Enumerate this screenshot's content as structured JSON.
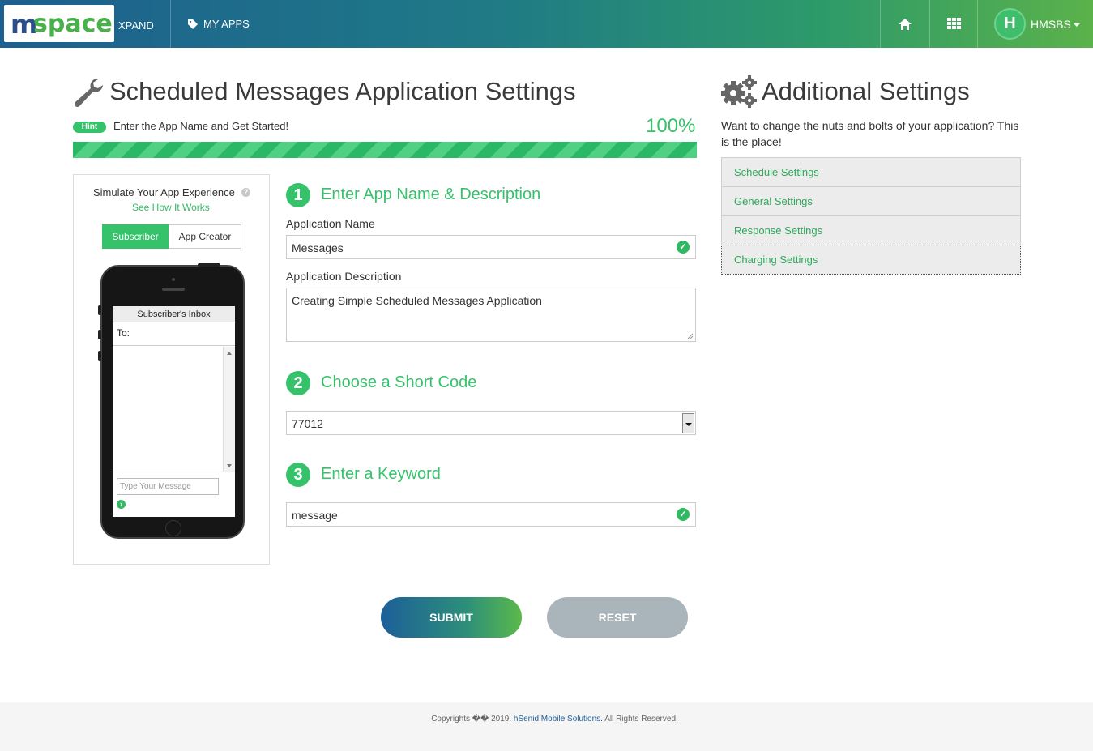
{
  "header": {
    "logo_m": "m",
    "logo_space": "space",
    "product": "XPAND",
    "my_apps": "MY APPS",
    "avatar_initial": "H",
    "username": "HMSBS",
    "icons": [
      "tags-icon",
      "home-icon",
      "grid-icon"
    ]
  },
  "main": {
    "title": "Scheduled Messages Application Settings",
    "hint_badge": "Hint",
    "hint_text": "Enter the App Name and Get Started!",
    "progress_label": "100%",
    "progress_value": 100
  },
  "simulator": {
    "title": "Simulate Your App Experience",
    "help": "?",
    "link": "See How It Works",
    "tabs": [
      {
        "label": "Subscriber",
        "active": true
      },
      {
        "label": "App Creator",
        "active": false
      }
    ],
    "inbox_title": "Subscriber's Inbox",
    "to_label": "To:",
    "placeholder": "Type Your Message"
  },
  "form": {
    "step1": {
      "number": "1",
      "title": "Enter App Name & Description"
    },
    "app_name_label": "Application Name",
    "app_name_value": "Messages",
    "app_desc_label": "Application Description",
    "app_desc_value": "Creating Simple Scheduled Messages Application",
    "step2": {
      "number": "2",
      "title": "Choose a Short Code"
    },
    "short_code_value": "77012",
    "step3": {
      "number": "3",
      "title": "Enter a Keyword"
    },
    "keyword_value": "message",
    "submit_label": "SUBMIT",
    "reset_label": "RESET"
  },
  "additional": {
    "title": "Additional Settings",
    "subtitle": "Want to change the nuts and bolts of your application? This is the place!",
    "items": [
      {
        "label": "Schedule Settings"
      },
      {
        "label": "General Settings"
      },
      {
        "label": "Response Settings"
      },
      {
        "label": "Charging Settings"
      }
    ]
  },
  "footer": {
    "copyright": "Copyrights �� 2019.",
    "company": "hSenid Mobile Solutions.",
    "rights": "All Rights Reserved."
  },
  "colors": {
    "accent": "#35c26a",
    "link": "#1f5d99",
    "reset": "#a9b5ba"
  }
}
